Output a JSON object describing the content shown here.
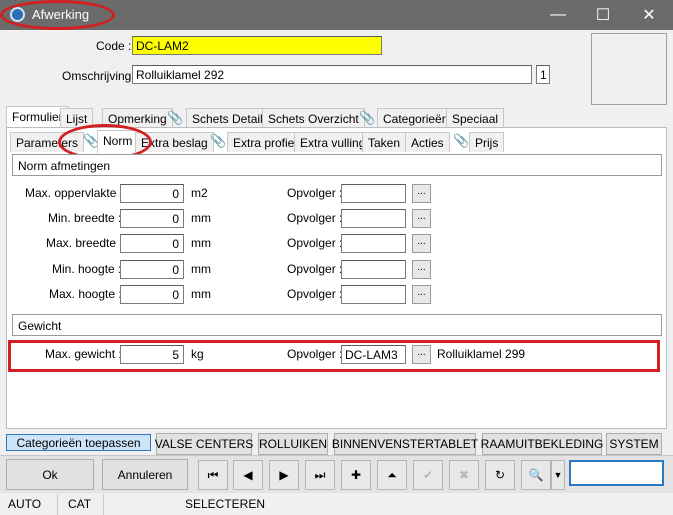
{
  "window": {
    "title": "Afwerking",
    "minimize": "—",
    "maximize": "☐",
    "close": "✕"
  },
  "header": {
    "code_label": "Code :",
    "code_value": "DC-LAM2",
    "omschrijving_label": "Omschrijving :",
    "omschrijving_value": "Rolluiklamel 292",
    "omschrijving_count": "1"
  },
  "main_tabs": [
    "Formulier",
    "Lijst",
    "Opmerking",
    "Schets Detail",
    "Schets Overzicht",
    "Categorieën",
    "Speciaal"
  ],
  "sub_tabs": [
    "Parameters",
    "Norm",
    "Extra beslag",
    "Extra profiel",
    "Extra vulling",
    "Taken",
    "Acties",
    "Prijs"
  ],
  "norm": {
    "section_title": "Norm afmetingen",
    "rows": [
      {
        "label": "Max. oppervlakte :",
        "value": "0",
        "unit": "m2",
        "opvolger_label": "Opvolger :",
        "opvolger": ""
      },
      {
        "label": "Min. breedte :",
        "value": "0",
        "unit": "mm",
        "opvolger_label": "Opvolger :",
        "opvolger": ""
      },
      {
        "label": "Max. breedte :",
        "value": "0",
        "unit": "mm",
        "opvolger_label": "Opvolger :",
        "opvolger": ""
      },
      {
        "label": "Min. hoogte :",
        "value": "0",
        "unit": "mm",
        "opvolger_label": "Opvolger :",
        "opvolger": ""
      },
      {
        "label": "Max. hoogte :",
        "value": "0",
        "unit": "mm",
        "opvolger_label": "Opvolger :",
        "opvolger": ""
      }
    ],
    "dots_label": "..."
  },
  "gewicht": {
    "section_title": "Gewicht",
    "label": "Max. gewicht :",
    "value": "5",
    "unit": "kg",
    "opvolger_label": "Opvolger :",
    "opvolger": "DC-LAM3",
    "opvolger_desc": "Rolluiklamel 299"
  },
  "categories": [
    "Categorieën toepassen",
    "VALSE CENTERS",
    "ROLLUIKEN",
    "BINNENVENSTERTABLET",
    "RAAMUITBEKLEDING",
    "SYSTEM"
  ],
  "buttons": {
    "ok": "Ok",
    "cancel": "Annuleren"
  },
  "nav_icons": [
    "first-record-icon",
    "previous-record-icon",
    "next-record-icon",
    "last-record-icon",
    "add-icon",
    "up-icon",
    "confirm-icon",
    "delete-icon",
    "refresh-icon",
    "find-icon"
  ],
  "nav_glyphs": [
    "⏮",
    "◀",
    "▶",
    "⏭",
    "✚",
    "⏶",
    "✔",
    "✖",
    "↻",
    "🔍"
  ],
  "status": [
    "AUTO",
    "CAT",
    "SELECTEREN"
  ]
}
